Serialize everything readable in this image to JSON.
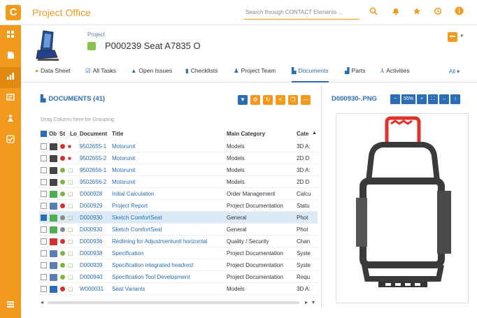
{
  "app": {
    "title": "Project Office",
    "logo": "C"
  },
  "search": {
    "placeholder": "Search through CONTACT Elements ..."
  },
  "top_icons": [
    "search-icon",
    "bell-icon",
    "star-icon",
    "history-icon",
    "info-icon"
  ],
  "sidebar": {
    "items": [
      "dashboard-icon",
      "file-icon",
      "chart-icon",
      "inbox-icon",
      "person-icon",
      "check-icon"
    ],
    "bottom": "list-icon"
  },
  "object": {
    "type": "Project",
    "title": "P000239 Seat A7835 O"
  },
  "tabs": [
    {
      "label": "Data Sheet",
      "icon": "info-icon"
    },
    {
      "label": "All Tasks",
      "icon": "tasks-icon"
    },
    {
      "label": "Open Issues",
      "icon": "warning-icon"
    },
    {
      "label": "Checklists",
      "icon": "checklist-icon"
    },
    {
      "label": "Project Team",
      "icon": "team-icon"
    },
    {
      "label": "Documents",
      "icon": "document-icon",
      "active": true
    },
    {
      "label": "Parts",
      "icon": "parts-icon"
    },
    {
      "label": "Activities",
      "icon": "activity-icon"
    }
  ],
  "tabs_all": "All",
  "documents": {
    "header": "DOCUMENTS (41)",
    "group_hint": "Drag Column here for Grouping",
    "columns": [
      "Ob",
      "St",
      "Lo",
      "Document",
      "Title",
      "Main Category",
      "Cate"
    ],
    "rows": [
      {
        "doc": "9502655-1",
        "title": "Motorunit",
        "category": "Models",
        "cate": "3D A:",
        "status": "red",
        "lock": "red",
        "icon": "cad"
      },
      {
        "doc": "9502655-2",
        "title": "Motorunit",
        "category": "Models",
        "cate": "2D D",
        "status": "red",
        "lock": "red",
        "icon": "cad"
      },
      {
        "doc": "9502656-1",
        "title": "Motorunit",
        "category": "Models",
        "cate": "3D A:",
        "status": "green",
        "lock": "green",
        "icon": "cad"
      },
      {
        "doc": "9502656-2",
        "title": "Motorunit",
        "category": "Models",
        "cate": "2D D",
        "status": "green",
        "lock": "green",
        "icon": "cad"
      },
      {
        "doc": "D000928",
        "title": "Initial Calculation",
        "category": "Order Management",
        "cate": "Calcu",
        "status": "green",
        "lock": "green",
        "icon": "xls"
      },
      {
        "doc": "D000929",
        "title": "Project Report",
        "category": "Project Documentation",
        "cate": "Statu",
        "status": "red",
        "lock": "green",
        "icon": "doc"
      },
      {
        "doc": "D000930",
        "title": "Sketch ComfortSeat",
        "category": "General",
        "cate": "Phot",
        "status": "gray",
        "lock": "green",
        "icon": "img",
        "selected": true
      },
      {
        "doc": "D000930",
        "title": "Sketch ComfortSeat",
        "category": "General",
        "cate": "Phot",
        "status": "gray",
        "lock": "green",
        "icon": "img"
      },
      {
        "doc": "D000936",
        "title": "Redlining for Adjustmentunit horizontal",
        "category": "Quality / Security",
        "cate": "Chan",
        "status": "red",
        "lock": "green",
        "icon": "pdf"
      },
      {
        "doc": "D000938",
        "title": "Specification",
        "category": "Project Documentation",
        "cate": "Syste",
        "status": "green",
        "lock": "green",
        "icon": "doc"
      },
      {
        "doc": "D000939",
        "title": "Specification integrated headrest",
        "category": "Project Documentation",
        "cate": "Syste",
        "status": "green",
        "lock": "green",
        "icon": "doc"
      },
      {
        "doc": "D000940",
        "title": "Specification Tool Development",
        "category": "Project Documentation",
        "cate": "Requ",
        "status": "green",
        "lock": "green",
        "icon": "doc"
      },
      {
        "doc": "W000031",
        "title": "Seat Variants",
        "category": "Models",
        "cate": "3D A:",
        "status": "red",
        "lock": "green",
        "icon": "grid"
      }
    ]
  },
  "preview": {
    "title": "D000930-.PNG",
    "zoom": "55%"
  },
  "colors": {
    "accent": "#f29a1e",
    "link": "#2a6db5",
    "status_red": "#d32f2f",
    "status_green": "#7cb342",
    "status_gray": "#888888"
  }
}
